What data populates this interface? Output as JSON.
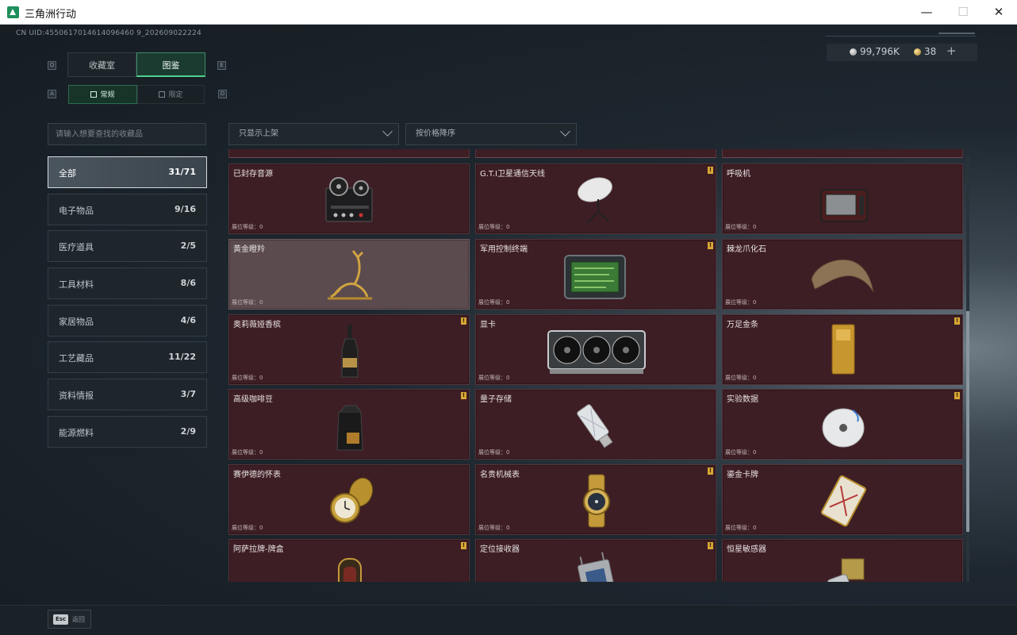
{
  "window": {
    "title": "三角洲行动",
    "minimize": "—",
    "maximize": "☐",
    "close": "✕"
  },
  "header": {
    "uid": "CN UID:4550617014614096460 9_202609022224"
  },
  "currency": {
    "silver": "99,796K",
    "gold": "38",
    "plus": "+"
  },
  "tabs": {
    "main": [
      {
        "label": "收藏室",
        "key": "Q"
      },
      {
        "label": "图鉴",
        "key": "E"
      }
    ],
    "sub": [
      {
        "label": "常规",
        "key": "A"
      },
      {
        "label": "限定",
        "key": "D"
      }
    ]
  },
  "search": {
    "placeholder": "请输入想要查找的收藏品"
  },
  "filters": {
    "shelf": "只显示上架",
    "sort": "按价格降序"
  },
  "categories": [
    {
      "name": "全部",
      "count": "31/71"
    },
    {
      "name": "电子物品",
      "count": "9/16"
    },
    {
      "name": "医疗道具",
      "count": "2/5"
    },
    {
      "name": "工具材料",
      "count": "8/6"
    },
    {
      "name": "家居物品",
      "count": "4/6"
    },
    {
      "name": "工艺藏品",
      "count": "11/22"
    },
    {
      "name": "资料情报",
      "count": "3/7"
    },
    {
      "name": "能源燃料",
      "count": "2/9"
    }
  ],
  "level_label": "展位等级：0",
  "badge_mark": "!",
  "items": [
    {
      "name": "已封存音源",
      "icon": "reel-recorder-icon"
    },
    {
      "name": "G.T.I卫星通信天线",
      "icon": "satellite-dish-icon"
    },
    {
      "name": "呼吸机",
      "icon": "ventilator-icon"
    },
    {
      "name": "黄金瞪羚",
      "icon": "golden-gazelle-icon"
    },
    {
      "name": "军用控制终端",
      "icon": "control-terminal-icon"
    },
    {
      "name": "棘龙爪化石",
      "icon": "claw-fossil-icon"
    },
    {
      "name": "奥莉薇娅香槟",
      "icon": "champagne-icon"
    },
    {
      "name": "显卡",
      "icon": "graphics-card-icon"
    },
    {
      "name": "万足金条",
      "icon": "gold-bar-icon"
    },
    {
      "name": "高级咖啡豆",
      "icon": "coffee-bag-icon"
    },
    {
      "name": "量子存储",
      "icon": "usb-drive-icon"
    },
    {
      "name": "实验数据",
      "icon": "disc-icon"
    },
    {
      "name": "赛伊德的怀表",
      "icon": "pocket-watch-icon"
    },
    {
      "name": "名贵机械表",
      "icon": "wrist-watch-icon"
    },
    {
      "name": "鎏金卡牌",
      "icon": "gilded-card-icon"
    },
    {
      "name": "阿萨拉牌-牌盒",
      "icon": "card-box-icon"
    },
    {
      "name": "定位接收器",
      "icon": "receiver-icon"
    },
    {
      "name": "恒星敏感器",
      "icon": "star-sensor-icon"
    }
  ],
  "footer": {
    "esc_key": "Esc",
    "esc_label": "返回"
  }
}
